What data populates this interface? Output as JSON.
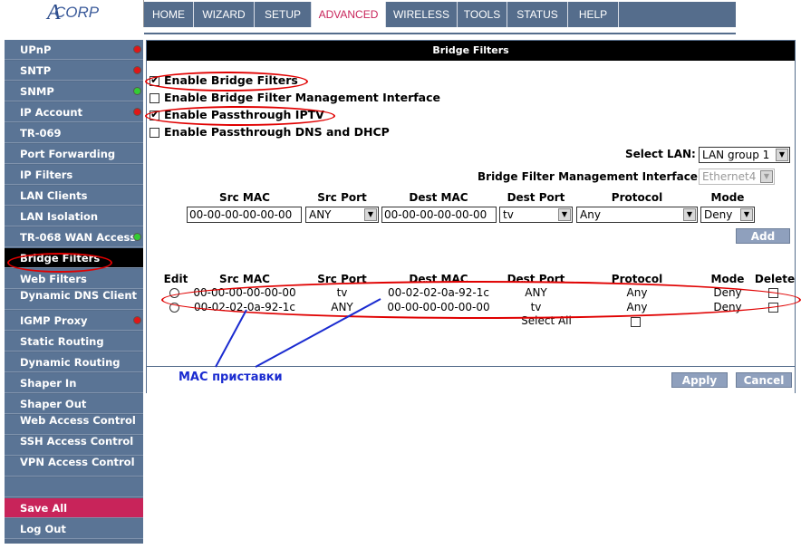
{
  "logo": {
    "text": "CORP",
    "mark": "A"
  },
  "nav": [
    "HOME",
    "WIZARD",
    "SETUP",
    "ADVANCED",
    "WIRELESS",
    "TOOLS",
    "STATUS",
    "HELP"
  ],
  "sidebar": [
    {
      "label": "UPnP",
      "dot": "red"
    },
    {
      "label": "SNTP",
      "dot": "red"
    },
    {
      "label": "SNMP",
      "dot": "green"
    },
    {
      "label": "IP Account",
      "dot": "red"
    },
    {
      "label": "TR-069"
    },
    {
      "label": "Port Forwarding"
    },
    {
      "label": "IP Filters"
    },
    {
      "label": "LAN Clients"
    },
    {
      "label": "LAN Isolation"
    },
    {
      "label": "TR-068 WAN Access",
      "dot": "green"
    },
    {
      "label": "Bridge Filters",
      "active": true
    },
    {
      "label": "Web Filters"
    },
    {
      "label": "Dynamic DNS Client"
    },
    {
      "label": "IGMP Proxy",
      "dot": "red"
    },
    {
      "label": "Static Routing"
    },
    {
      "label": "Dynamic Routing"
    },
    {
      "label": "Shaper In"
    },
    {
      "label": "Shaper Out"
    },
    {
      "label": "Web Access Control"
    },
    {
      "label": "SSH Access Control"
    },
    {
      "label": "VPN Access Control"
    },
    {
      "label": ""
    },
    {
      "label": "Save All",
      "pink": true
    },
    {
      "label": "Log Out"
    }
  ],
  "panel": {
    "title": "Bridge Filters",
    "options": [
      {
        "label": "Enable Bridge Filters",
        "checked": true
      },
      {
        "label": "Enable Bridge Filter Management Interface",
        "checked": false
      },
      {
        "label": "Enable Passthrough IPTV",
        "checked": true
      },
      {
        "label": "Enable Passthrough DNS and DHCP",
        "checked": false
      }
    ],
    "select_lan_label": "Select LAN:",
    "select_lan_value": "LAN group 1",
    "mgmt_iface_label": "Bridge Filter Management Interface:",
    "mgmt_iface_value": "Ethernet4",
    "form_headers": [
      "Src MAC",
      "Src Port",
      "Dest MAC",
      "Dest Port",
      "Protocol",
      "Mode"
    ],
    "form": {
      "src_mac": "00-00-00-00-00-00",
      "src_port": "ANY",
      "dest_mac": "00-00-00-00-00-00",
      "dest_port": "tv",
      "protocol": "Any",
      "mode": "Deny"
    },
    "add_label": "Add",
    "table_headers": [
      "Edit",
      "Src MAC",
      "Src Port",
      "Dest MAC",
      "Dest Port",
      "Protocol",
      "Mode",
      "Delete"
    ],
    "rows": [
      {
        "src_mac": "00-00-00-00-00-00",
        "src_port": "tv",
        "dest_mac": "00-02-02-0a-92-1c",
        "dest_port": "ANY",
        "protocol": "Any",
        "mode": "Deny"
      },
      {
        "src_mac": "00-02-02-0a-92-1c",
        "src_port": "ANY",
        "dest_mac": "00-00-00-00-00-00",
        "dest_port": "tv",
        "protocol": "Any",
        "mode": "Deny"
      }
    ],
    "select_all_label": "Select All",
    "apply_label": "Apply",
    "cancel_label": "Cancel"
  },
  "annotation": {
    "text": "MAC приставки",
    "color": "#1a2bd0",
    "ellipse_color": "#e00000"
  },
  "colors": {
    "nav_bg": "#556d8c",
    "active_nav_text": "#c8245a",
    "save_all_bg": "#c8245a",
    "button_bg": "#8fa0bd"
  }
}
